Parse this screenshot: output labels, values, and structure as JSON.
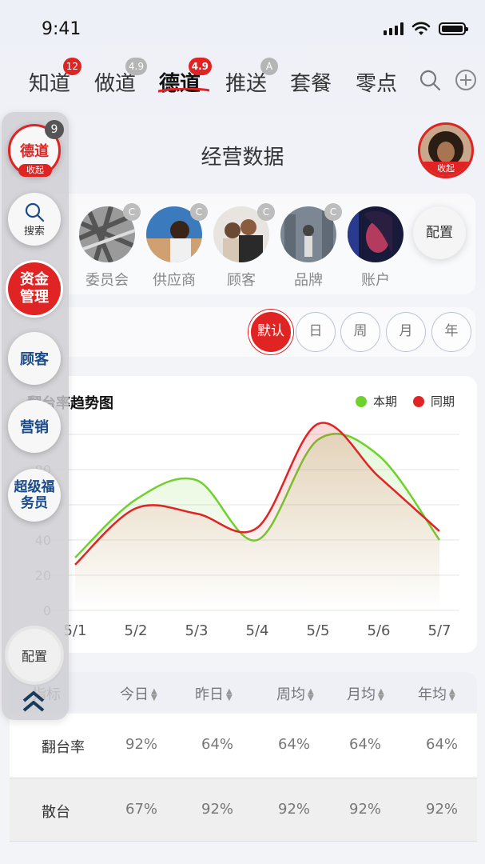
{
  "status_bar": {
    "time": "9:41"
  },
  "top_tabs": [
    {
      "label": "知道",
      "badge": "12",
      "badge_color": "red"
    },
    {
      "label": "做道",
      "badge": "4.9",
      "badge_color": "gray"
    },
    {
      "label": "德道",
      "badge": "4.9",
      "badge_color": "red",
      "active": true
    },
    {
      "label": "推送",
      "badge": "A",
      "badge_color": "gray"
    },
    {
      "label": "套餐"
    },
    {
      "label": "零点"
    }
  ],
  "header": {
    "title": "经营数据",
    "avatar_tag": "收起"
  },
  "entities": [
    {
      "label": "委员会",
      "badge": "C"
    },
    {
      "label": "供应商",
      "badge": "C"
    },
    {
      "label": "顾客",
      "badge": "C"
    },
    {
      "label": "品牌",
      "badge": "C"
    },
    {
      "label": "账户"
    }
  ],
  "entity_config_label": "配置",
  "periods": [
    "默认",
    "日",
    "周",
    "月",
    "年"
  ],
  "side_menu": {
    "badge": "9",
    "items": [
      {
        "label": "德道",
        "sub": "收起"
      },
      {
        "label": "搜索"
      },
      {
        "label": "资金管理"
      },
      {
        "label": "顾客"
      },
      {
        "label": "营销"
      },
      {
        "label": "超级福务员"
      }
    ],
    "config_label": "配置"
  },
  "chart_data": {
    "type": "line",
    "title": "翻台率趋势图",
    "x": [
      "5/1",
      "5/2",
      "5/3",
      "5/4",
      "5/5",
      "5/6",
      "5/7"
    ],
    "y_ticks": [
      0,
      20,
      40,
      60,
      80,
      100
    ],
    "ylim": [
      0,
      100
    ],
    "series": [
      {
        "name": "本期",
        "color": "#6fd12e",
        "values": [
          30,
          63,
          74,
          40,
          97,
          88,
          40
        ]
      },
      {
        "name": "同期",
        "color": "#e02424",
        "values": [
          26,
          58,
          55,
          47,
          106,
          76,
          45
        ]
      }
    ],
    "legend_position": "top-right",
    "grid": true
  },
  "table": {
    "headers": [
      "指标",
      "今日",
      "昨日",
      "周均",
      "月均",
      "年均"
    ],
    "rows": [
      {
        "label": "翻台率",
        "values": [
          "92%",
          "64%",
          "64%",
          "64%",
          "64%"
        ]
      },
      {
        "label": "散台",
        "values": [
          "67%",
          "92%",
          "92%",
          "92%",
          "92%"
        ]
      }
    ]
  }
}
